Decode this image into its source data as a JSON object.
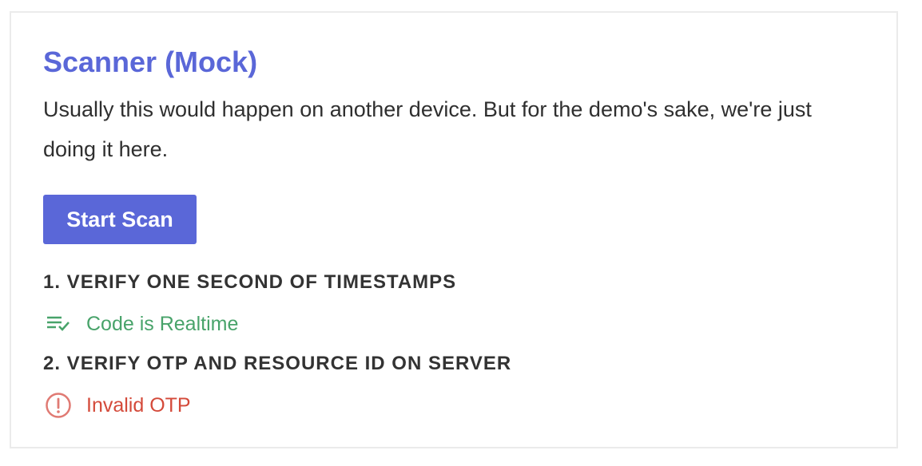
{
  "scanner": {
    "title": "Scanner (Mock)",
    "description": "Usually this would happen on another device. But for the demo's sake, we're just doing it here.",
    "start_button_label": "Start Scan"
  },
  "steps": [
    {
      "heading": "1. VERIFY ONE SECOND OF TIMESTAMPS",
      "status_text": "Code is Realtime",
      "status_icon": "playlist-check-icon",
      "status_color": "#48a36a"
    },
    {
      "heading": "2. VERIFY OTP AND RESOURCE ID ON SERVER",
      "status_text": "Invalid OTP",
      "status_icon": "alert-circle-icon",
      "status_color": "#d44a3a"
    }
  ],
  "colors": {
    "accent": "#5a67d8",
    "success": "#48a36a",
    "error": "#d44a3a"
  }
}
